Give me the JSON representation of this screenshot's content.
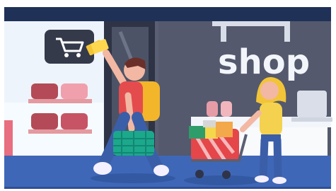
{
  "scene": {
    "sign_text": "shop",
    "sign_icon": "shopping-cart-icon"
  },
  "colors": {
    "frame_navy": "#1f3157",
    "store_wall": "#5a5f73",
    "store_wall_dark": "#4a4f62",
    "floor_blue": "#3f67b7",
    "shelf_pink": "#e39aa0",
    "shoe_red": "#b44a57",
    "sign_dark": "#343a4a",
    "character_shirt": "#e44b4d",
    "backpack_orange": "#f3b52a",
    "basket_green": "#1ca88b",
    "cart_red": "#e4464a",
    "woman_hair": "#f2c437",
    "woman_top": "#f4d24f",
    "woman_pants": "#3b5ea8"
  }
}
